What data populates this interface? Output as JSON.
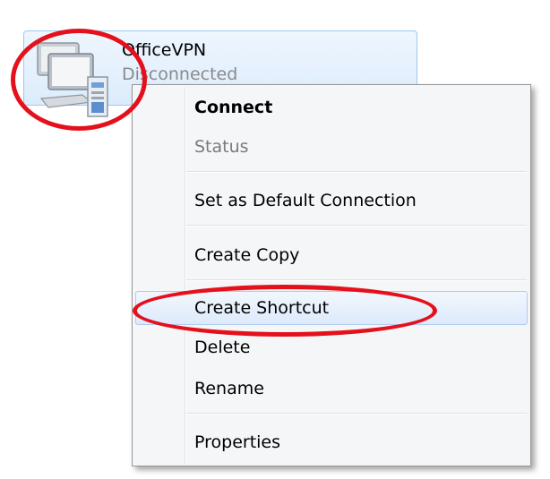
{
  "connection": {
    "name": "OfficeVPN",
    "status": "Disconnected",
    "icon": "network-computer-icon"
  },
  "menu": {
    "items": [
      {
        "label": "Connect",
        "style": "bold"
      },
      {
        "label": "Status",
        "style": "disabled"
      },
      {
        "label": "Set as Default Connection",
        "style": "normal"
      },
      {
        "label": "Create Copy",
        "style": "normal"
      },
      {
        "label": "Create Shortcut",
        "style": "hover"
      },
      {
        "label": "Delete",
        "style": "normal"
      },
      {
        "label": "Rename",
        "style": "normal"
      },
      {
        "label": "Properties",
        "style": "normal"
      }
    ]
  },
  "colors": {
    "annotation": "#e4111c",
    "hover_border": "#aeccf0",
    "tile_border": "#9ec9ef"
  }
}
